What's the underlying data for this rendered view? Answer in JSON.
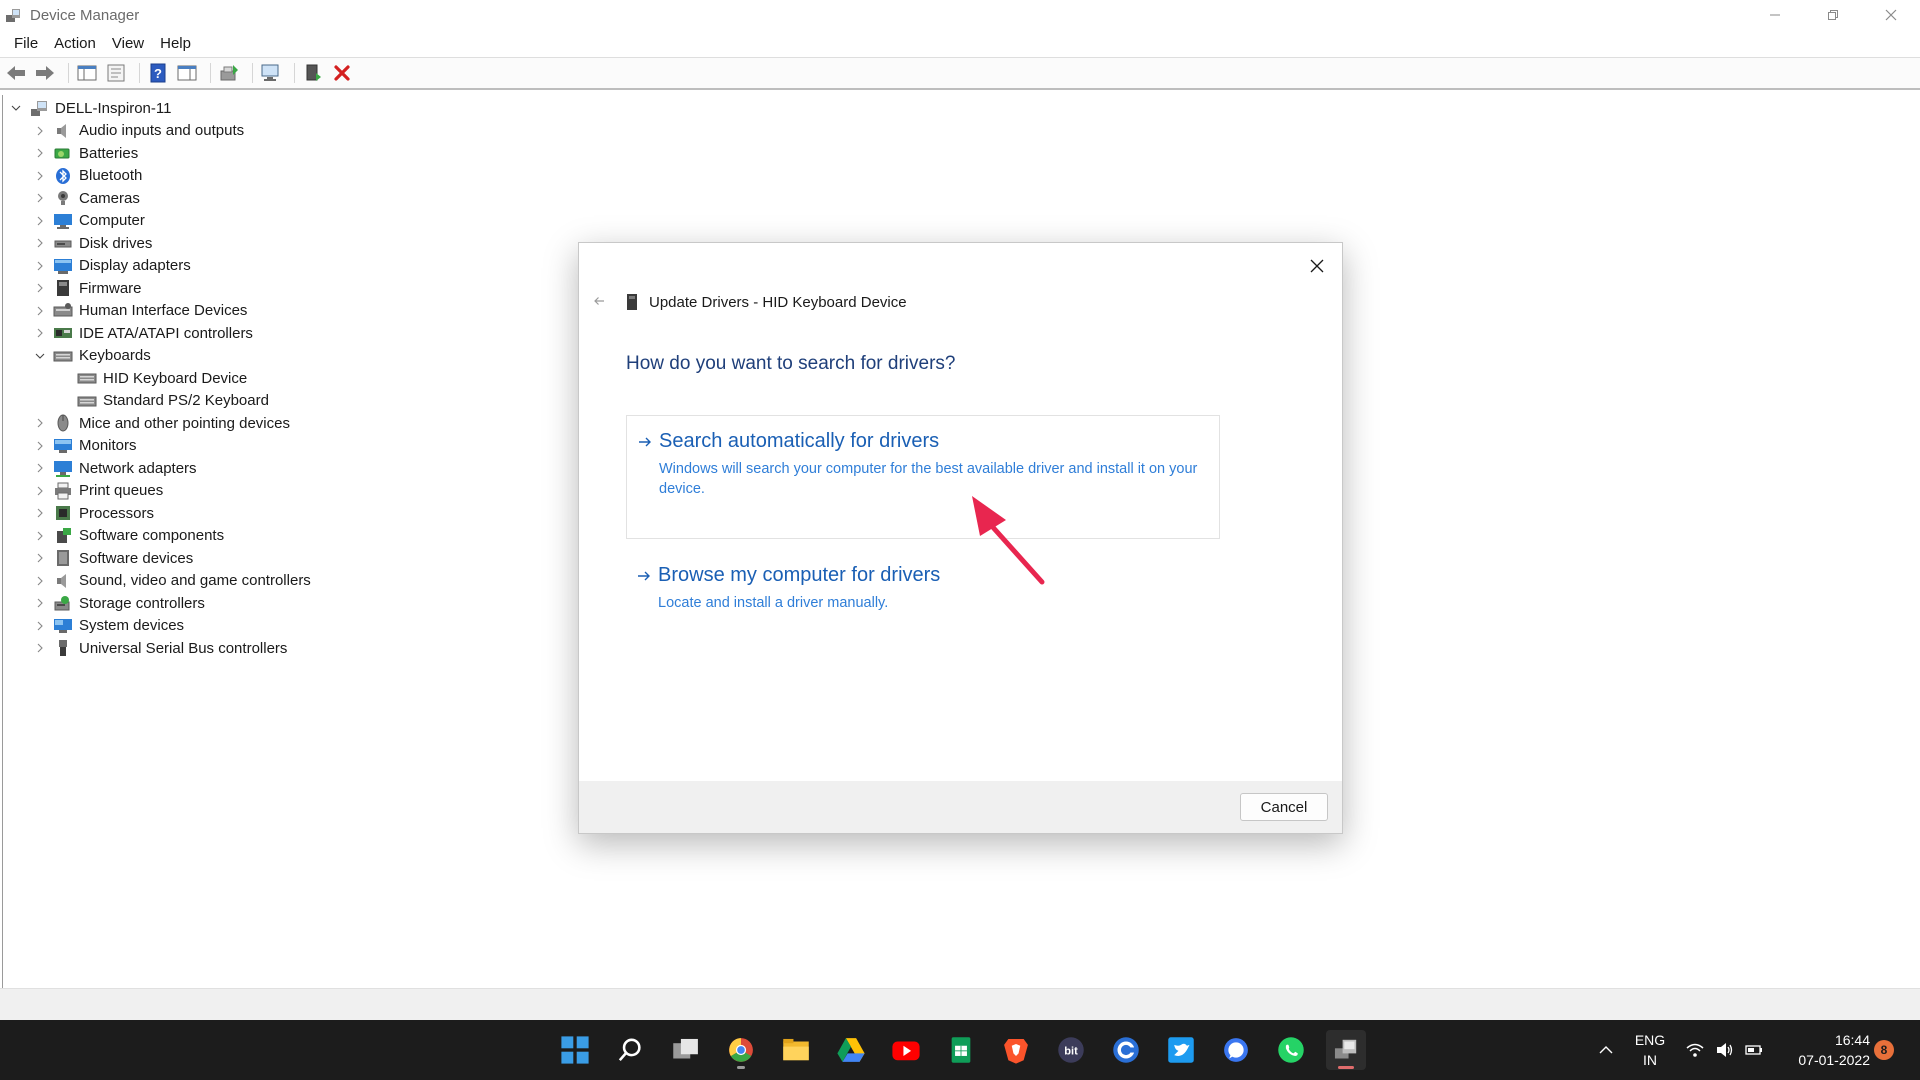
{
  "window": {
    "title": "Device Manager"
  },
  "menu": [
    "File",
    "Action",
    "View",
    "Help"
  ],
  "toolbar": {
    "icons": [
      "back-icon",
      "forward-icon",
      "show-hide-console-tree-icon",
      "properties-icon",
      "help-icon",
      "show-action-pane-icon",
      "update-driver-icon",
      "scan-hardware-icon",
      "add-driver-icon",
      "uninstall-device-icon"
    ],
    "uninstall_color": "#d42020"
  },
  "tree": {
    "root": "DELL-Inspiron-11",
    "categories": [
      {
        "label": "Audio inputs and outputs",
        "icon": "speaker-icon",
        "expanded": false
      },
      {
        "label": "Batteries",
        "icon": "battery-icon",
        "expanded": false
      },
      {
        "label": "Bluetooth",
        "icon": "bluetooth-icon",
        "expanded": false
      },
      {
        "label": "Cameras",
        "icon": "camera-icon",
        "expanded": false
      },
      {
        "label": "Computer",
        "icon": "computer-icon",
        "expanded": false
      },
      {
        "label": "Disk drives",
        "icon": "disk-drive-icon",
        "expanded": false
      },
      {
        "label": "Display adapters",
        "icon": "display-adapter-icon",
        "expanded": false
      },
      {
        "label": "Firmware",
        "icon": "firmware-icon",
        "expanded": false
      },
      {
        "label": "Human Interface Devices",
        "icon": "hid-icon",
        "expanded": false
      },
      {
        "label": "IDE ATA/ATAPI controllers",
        "icon": "ide-controller-icon",
        "expanded": false
      },
      {
        "label": "Keyboards",
        "icon": "keyboard-icon",
        "expanded": true,
        "children": [
          "HID Keyboard Device",
          "Standard PS/2 Keyboard"
        ]
      },
      {
        "label": "Mice and other pointing devices",
        "icon": "mouse-icon",
        "expanded": false
      },
      {
        "label": "Monitors",
        "icon": "monitor-icon",
        "expanded": false
      },
      {
        "label": "Network adapters",
        "icon": "network-adapter-icon",
        "expanded": false
      },
      {
        "label": "Print queues",
        "icon": "printer-icon",
        "expanded": false
      },
      {
        "label": "Processors",
        "icon": "processor-icon",
        "expanded": false
      },
      {
        "label": "Software components",
        "icon": "software-component-icon",
        "expanded": false
      },
      {
        "label": "Software devices",
        "icon": "software-device-icon",
        "expanded": false
      },
      {
        "label": "Sound, video and game controllers",
        "icon": "speaker-icon",
        "expanded": false
      },
      {
        "label": "Storage controllers",
        "icon": "storage-controller-icon",
        "expanded": false
      },
      {
        "label": "System devices",
        "icon": "system-devices-icon",
        "expanded": false
      },
      {
        "label": "Universal Serial Bus controllers",
        "icon": "usb-icon",
        "expanded": false
      }
    ]
  },
  "dialog": {
    "header": "Update Drivers - HID Keyboard Device",
    "question": "How do you want to search for drivers?",
    "option_auto": {
      "title": "Search automatically for drivers",
      "desc": "Windows will search your computer for the best available driver and install it on your device."
    },
    "option_browse": {
      "title": "Browse my computer for drivers",
      "desc": "Locate and install a driver manually."
    },
    "cancel_label": "Cancel",
    "annotation_color": "#e8264f"
  },
  "taskbar": {
    "apps": [
      "start-icon",
      "search-icon",
      "task-view-icon",
      "chrome-icon",
      "file-explorer-icon",
      "google-drive-icon",
      "youtube-icon",
      "google-sheets-icon",
      "brave-icon",
      "bitwarden-icon",
      "ccleaner-icon",
      "twitter-icon",
      "signal-icon",
      "whatsapp-icon",
      "device-manager-icon"
    ],
    "lang_top": "ENG",
    "lang_bottom": "IN",
    "time": "16:44",
    "date": "07-01-2022",
    "notification_count": "8"
  }
}
